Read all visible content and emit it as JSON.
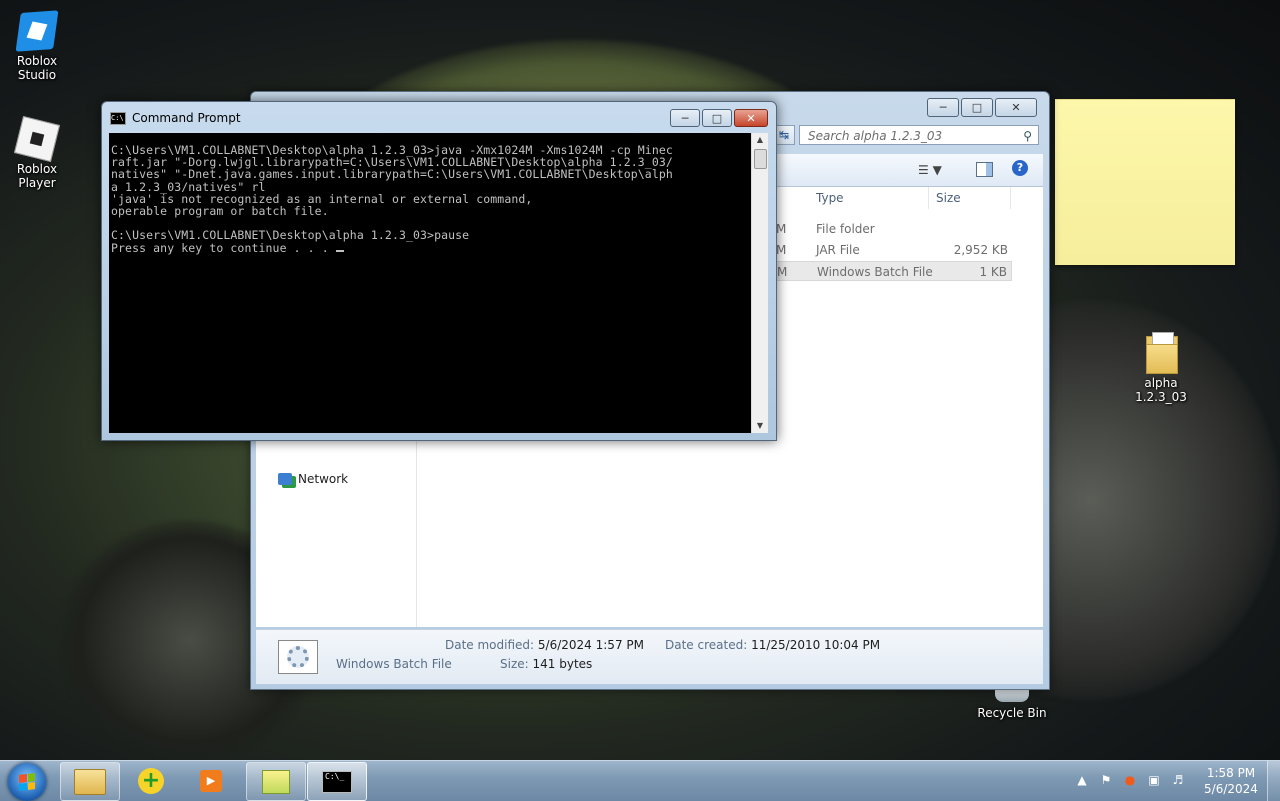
{
  "desktop": {
    "icons": [
      {
        "label": "Roblox Studio",
        "label_line1": "Roblox",
        "label_line2": "Studio"
      },
      {
        "label": "Roblox Player"
      },
      {
        "label": "alpha 1.2.3_03",
        "label_line1": "alpha",
        "label_line2": "1.2.3_03"
      },
      {
        "label": "Recycle Bin"
      }
    ],
    "sticky_note": {
      "text": "",
      "color": "#fdf7ab"
    }
  },
  "explorer": {
    "search_placeholder": "Search alpha 1.2.3_03",
    "columns": [
      {
        "label": "Type"
      },
      {
        "label": "Size"
      }
    ],
    "rows": [
      {
        "cut": "M",
        "type": "File folder",
        "size": "",
        "selected": false
      },
      {
        "cut": "M",
        "type": "JAR File",
        "size": "2,952 KB",
        "selected": false
      },
      {
        "cut": "M",
        "type": "Windows Batch File",
        "size": "1 KB",
        "selected": true
      }
    ],
    "nav": {
      "network": "Network"
    },
    "details": {
      "file_type": "Windows Batch File",
      "date_modified_label": "Date modified:",
      "date_modified": "5/6/2024 1:57 PM",
      "size_label": "Size:",
      "size": "141 bytes",
      "date_created_label": "Date created:",
      "date_created": "11/25/2010 10:04 PM"
    }
  },
  "cmd": {
    "title": "Command Prompt",
    "icon_text": "C:\\",
    "output": "C:\\Users\\VM1.COLLABNET\\Desktop\\alpha 1.2.3_03>java -Xmx1024M -Xms1024M -cp Minec\nraft.jar \"-Dorg.lwjgl.librarypath=C:\\Users\\VM1.COLLABNET\\Desktop\\alpha 1.2.3_03/\nnatives\" \"-Dnet.java.games.input.librarypath=C:\\Users\\VM1.COLLABNET\\Desktop\\alph\na 1.2.3_03/natives\" rl\n'java' is not recognized as an internal or external command,\noperable program or batch file.\n\nC:\\Users\\VM1.COLLABNET\\Desktop\\alpha 1.2.3_03>pause\nPress any key to continue . . . "
  },
  "taskbar": {
    "clock_time": "1:58 PM",
    "clock_date": "5/6/2024",
    "cmd_icon_text": "C:\\_",
    "media_icon": "▶",
    "plus_icon": "+"
  },
  "colors": {
    "taskbar": "#7f9ab4",
    "console_bg": "#000000",
    "console_fg": "#c0c0c0",
    "sticky": "#fdf7ab"
  }
}
